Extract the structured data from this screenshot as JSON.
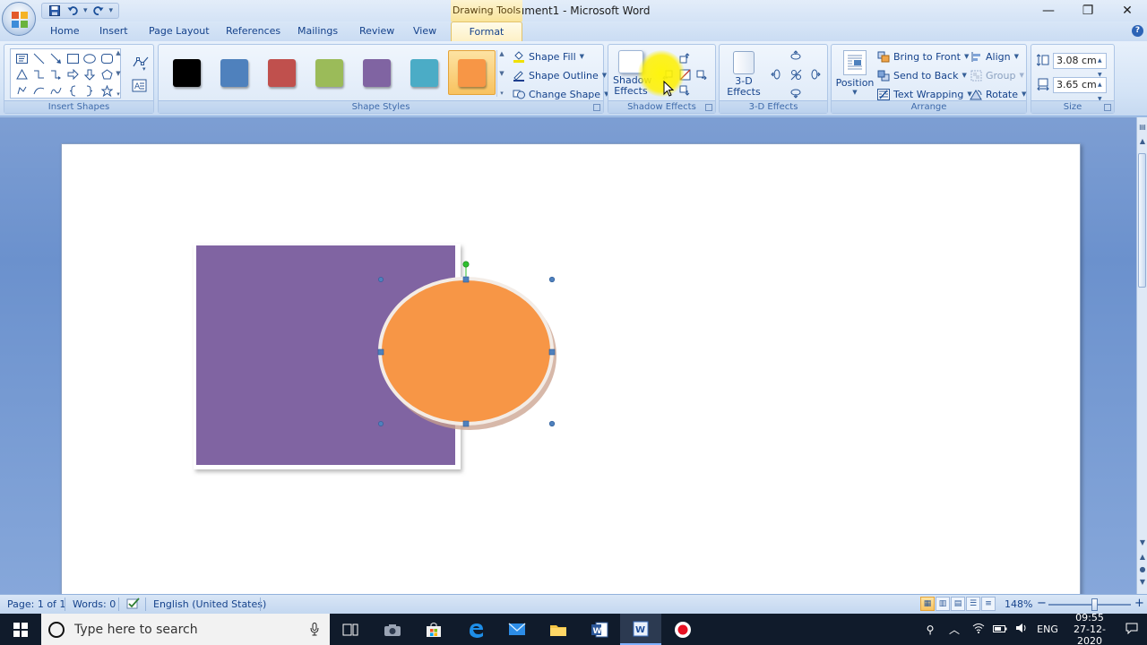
{
  "title_bar": {
    "document_title": "Document1 - Microsoft Word",
    "context_tools_label": "Drawing Tools",
    "minimize_glyph": "—",
    "restore_glyph": "❐",
    "close_glyph": "✕"
  },
  "tabs": {
    "home": "Home",
    "insert": "Insert",
    "page_layout": "Page Layout",
    "references": "References",
    "mailings": "Mailings",
    "review": "Review",
    "view": "View",
    "format": "Format",
    "help": "?"
  },
  "ribbon": {
    "insert_shapes": {
      "label": "Insert Shapes"
    },
    "shape_styles": {
      "label": "Shape Styles",
      "swatch_colors": [
        "#000000",
        "#4f81bd",
        "#c0504d",
        "#9bbb59",
        "#8064a2",
        "#4bacc6",
        "#f79646"
      ],
      "shape_fill": "Shape Fill",
      "shape_outline": "Shape Outline",
      "change_shape": "Change Shape"
    },
    "shadow_effects": {
      "label": "Shadow Effects",
      "button_line1": "Shadow",
      "button_line2": "Effects"
    },
    "three_d_effects": {
      "label": "3-D Effects",
      "button_line1": "3-D",
      "button_line2": "Effects"
    },
    "arrange": {
      "label": "Arrange",
      "position": "Position",
      "bring_to_front": "Bring to Front",
      "send_to_back": "Send to Back",
      "text_wrapping": "Text Wrapping",
      "align": "Align",
      "group": "Group",
      "rotate": "Rotate"
    },
    "size": {
      "label": "Size",
      "height": "3.08 cm",
      "width": "3.65 cm"
    }
  },
  "canvas": {
    "rectangle_color": "#8064a2",
    "ellipse_color": "#f79646",
    "handle_color": "#4f81bd",
    "rotate_handle_color": "#2fc02f"
  },
  "status_bar": {
    "page": "Page: 1 of 1",
    "words": "Words: 0",
    "language": "English (United States)",
    "zoom": "148%",
    "zoom_out": "−",
    "zoom_in": "+"
  },
  "taskbar": {
    "search_placeholder": "Type here to search",
    "language": "ENG",
    "time": "09:55",
    "date": "27-12-2020"
  }
}
